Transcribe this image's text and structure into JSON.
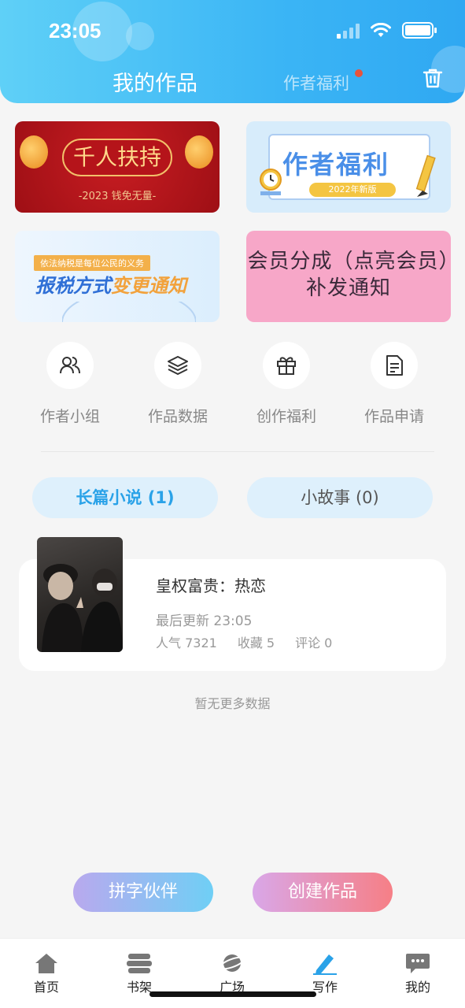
{
  "status_bar": {
    "time": "23:05"
  },
  "header": {
    "tab_active": "我的作品",
    "tab_inactive": "作者福利",
    "has_notification_dot": true,
    "trash_icon": "trash-icon",
    "colors": {
      "gradient_start": "#5fd0f7",
      "gradient_end": "#2fa8f2"
    }
  },
  "banners": [
    {
      "title": "千人扶持",
      "subtitle": "-2023 钱免无量-"
    },
    {
      "title": "作者福利",
      "subtitle": "2022年新版"
    },
    {
      "title_part1": "报税方式",
      "title_part2": "变更通知",
      "subtitle": "依法纳税是每位公民的义务"
    },
    {
      "title": "会员分成（点亮会员）补发通知"
    }
  ],
  "quick_actions": [
    {
      "label": "作者小组",
      "icon": "users-icon"
    },
    {
      "label": "作品数据",
      "icon": "layers-icon"
    },
    {
      "label": "创作福利",
      "icon": "gift-icon"
    },
    {
      "label": "作品申请",
      "icon": "document-icon"
    }
  ],
  "categories": [
    {
      "label": "长篇小说 (1)",
      "active": true
    },
    {
      "label": "小故事 (0)",
      "active": false
    }
  ],
  "work": {
    "title": "皇权富贵：热恋",
    "last_update": "最后更新 23:05",
    "popularity": "人气 7321",
    "favorites": "收藏 5",
    "comments": "评论 0"
  },
  "no_more_text": "暂无更多数据",
  "actions": {
    "partner_label": "拼字伙伴",
    "create_label": "创建作品"
  },
  "bottom_nav": [
    {
      "label": "首页",
      "icon": "home-icon"
    },
    {
      "label": "书架",
      "icon": "bookshelf-icon"
    },
    {
      "label": "广场",
      "icon": "planet-icon"
    },
    {
      "label": "写作",
      "icon": "pen-icon",
      "active": true
    },
    {
      "label": "我的",
      "icon": "chat-icon"
    }
  ],
  "colors": {
    "accent": "#2aa2e8",
    "tab_bg": "#def0fc",
    "pill_partner_end": "#6fcff5",
    "pill_create_end": "#f67f86"
  }
}
